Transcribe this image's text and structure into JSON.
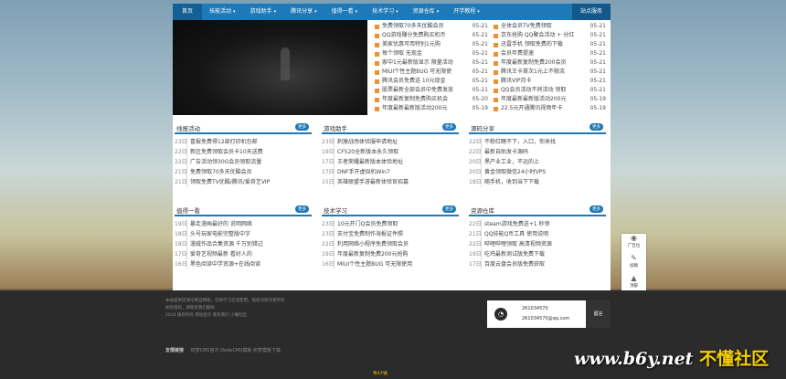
{
  "nav": {
    "home": "首页",
    "items": [
      "技能活动",
      "游戏助手",
      "腾讯分享",
      "值得一看",
      "技术学习",
      "资源仓库",
      "开学教程"
    ],
    "right": "站点服务"
  },
  "headlines_left": [
    {
      "t": "免费领取70多天优酷会员",
      "d": "05-21"
    },
    {
      "t": "QQ游戏赚分免费购买机币",
      "d": "05-21"
    },
    {
      "t": "美家优惠可用特别1元购",
      "d": "05-21"
    },
    {
      "t": "每个领取 无现金",
      "d": "05-21"
    },
    {
      "t": "家中1元最新版显示 限量活动",
      "d": "05-21"
    },
    {
      "t": "MIUI个性主题BUG 可无限使",
      "d": "05-21"
    },
    {
      "t": "腾讯会员免费送 10元现金",
      "d": "05-21"
    },
    {
      "t": "股票最新全部会员中免费发放",
      "d": "05-21"
    },
    {
      "t": "年度最新复制免费购买机会",
      "d": "05-20"
    },
    {
      "t": "年度最新最新版活动200元",
      "d": "05-19"
    }
  ],
  "headlines_right": [
    {
      "t": "全体会员TV免费领取",
      "d": "05-21"
    },
    {
      "t": "京东抢购 QQ聚会活动 + 分红",
      "d": "05-21"
    },
    {
      "t": "迅雷手机 领取免费的下载",
      "d": "05-21"
    },
    {
      "t": "会员年费提速",
      "d": "05-21"
    },
    {
      "t": "年度最新复制免费200会员",
      "d": "05-21"
    },
    {
      "t": "腾讯王卡首次1元上不限流",
      "d": "05-21"
    },
    {
      "t": "腾讯VIP月卡",
      "d": "05-21"
    },
    {
      "t": "QQ会员活动不同活动 领取",
      "d": "05-21"
    },
    {
      "t": "年度最新最新版活动200元",
      "d": "05-19"
    },
    {
      "t": "22.5元开通腾讯视频年卡",
      "d": "05-19"
    }
  ],
  "boxes": [
    {
      "title": "线报活动",
      "more": "更多",
      "items": [
        {
          "d": "23日",
          "t": "喜报免费得12部打印机包邮"
        },
        {
          "d": "22日",
          "t": "新区免费领取会员卡10天送费"
        },
        {
          "d": "22日",
          "t": "广告活动领30G会员领取流量"
        },
        {
          "d": "21日",
          "t": "免费领取70多天优酷会员"
        },
        {
          "d": "21日",
          "t": "领取免费TV优酷/腾讯/爱奇艺VIP"
        }
      ]
    },
    {
      "title": "游戏助手",
      "more": "更多",
      "items": [
        {
          "d": "23日",
          "t": "刺激战场体验服申请地址"
        },
        {
          "d": "19日",
          "t": "CF520全新版本永久领取"
        },
        {
          "d": "17日",
          "t": "王者荣耀最新版本体验地址"
        },
        {
          "d": "17日",
          "t": "DNF手开虚拟机Win7"
        },
        {
          "d": "15日",
          "t": "英雄联盟手游最新体验官招募"
        }
      ]
    },
    {
      "title": "源码分享",
      "more": "更多",
      "items": [
        {
          "d": "22日",
          "t": "不粉红瞎不下，入口，你来找"
        },
        {
          "d": "22日",
          "t": "最新自助发卡源码"
        },
        {
          "d": "20日",
          "t": "黑产业工业，不远的上"
        },
        {
          "d": "20日",
          "t": "黄金领取微信24小时VPS"
        },
        {
          "d": "18日",
          "t": "随手机，收到当下下载"
        }
      ]
    },
    {
      "title": "值得一看",
      "more": "更多",
      "items": [
        {
          "d": "19日",
          "t": "暴走漫画最好的 说明网络"
        },
        {
          "d": "18日",
          "t": "头号玩家电影完整版中字"
        },
        {
          "d": "18日",
          "t": "漫威作品合集资源 千万别错过"
        },
        {
          "d": "17日",
          "t": "爱奇艺视频最新 看好人的"
        },
        {
          "d": "16日",
          "t": "黑色阅读中学资源+在线阅读"
        }
      ]
    },
    {
      "title": "技术学习",
      "more": "更多",
      "items": [
        {
          "d": "23日",
          "t": "10元开门Q会员免费领取"
        },
        {
          "d": "23日",
          "t": "支付宝免费制作海报证件照"
        },
        {
          "d": "22日",
          "t": "利用网络小程序免费领取会员"
        },
        {
          "d": "19日",
          "t": "年度最新复制免费200元抢购"
        },
        {
          "d": "16日",
          "t": "MIUI个性主题BUG 可无限使用"
        }
      ]
    },
    {
      "title": "资源仓库",
      "more": "更多",
      "items": [
        {
          "d": "22日",
          "t": "steam游戏免费送+1 秒领"
        },
        {
          "d": "21日",
          "t": "QQ技能Q币工具 使用说明"
        },
        {
          "d": "22日",
          "t": "哔哩哔哩领取 高清视频资源"
        },
        {
          "d": "19日",
          "t": "吃鸡最新测试版免费下载"
        },
        {
          "d": "17日",
          "t": "百度云盘会员版免费获取"
        }
      ]
    }
  ],
  "side": {
    "items": [
      {
        "g": "◉",
        "l": "广告位"
      },
      {
        "g": "✎",
        "l": "投稿"
      },
      {
        "g": "▲",
        "l": "顶部"
      }
    ]
  },
  "footer": {
    "lines": [
      "本站提供资源均来自网络，仅供学习交流使用，版权归原作者所有",
      "如有侵权，请联系我们删除",
      "2018 版权所有 网站首页 联系我们 小懂社区"
    ]
  },
  "contact": {
    "qq": "261034570",
    "email": "261034570@qq.com",
    "button": "留言"
  },
  "links": {
    "label": "友情链接",
    "items": [
      "织梦CMS官方",
      "DedeCMS模板",
      "织梦模板下载"
    ]
  },
  "copyright": "粤ICP备",
  "watermark": {
    "site": "www.b6y.net",
    "tag": "不懂社区"
  }
}
